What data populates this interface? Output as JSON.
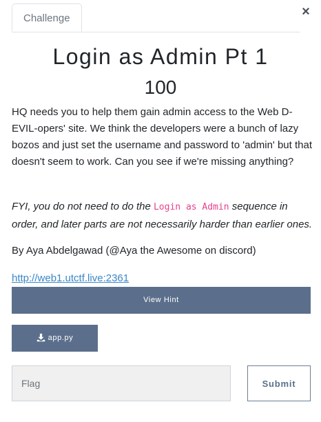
{
  "modal": {
    "tab_label": "Challenge",
    "close_glyph": "×"
  },
  "challenge": {
    "title": "Login as Admin Pt 1",
    "points": "100",
    "description": "HQ needs you to help them gain admin access to the Web D-EVIL-opers' site. We think the developers were a bunch of lazy bozos and just set the username and password to 'admin' but that doesn't seem to work. Can you see if we're missing anything?",
    "fyi_before": "FYI, you do not need to do the ",
    "fyi_code": "Login as Admin",
    "fyi_after": " sequence in order, and later parts are not necessarily harder than earlier ones.",
    "author": "By Aya Abdelgawad (@Aya the Awesome on discord)",
    "link": "http://web1.utctf.live:2361"
  },
  "actions": {
    "hint_label": "View Hint",
    "file_label": "app.py",
    "file_icon": "download-icon"
  },
  "flag_form": {
    "placeholder": "Flag",
    "value": "",
    "submit_label": "Submit"
  },
  "colors": {
    "button_bg": "#5b6f8c",
    "link": "#3a87c8",
    "code": "#e83e8c"
  }
}
